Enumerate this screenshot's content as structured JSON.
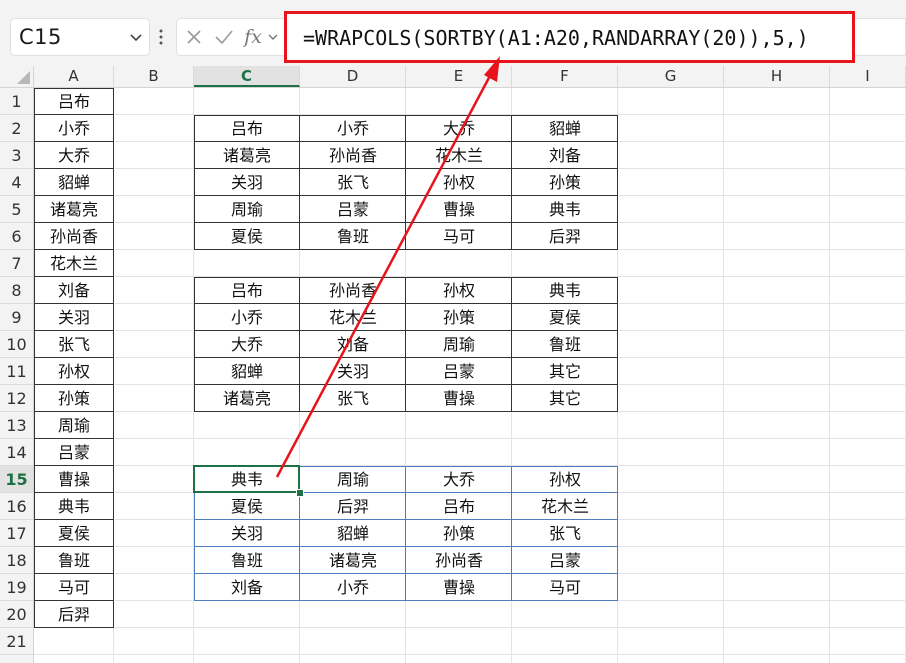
{
  "name_box": "C15",
  "formula": "=WRAPCOLS(SORTBY(A1:A20,RANDARRAY(20)),5,)",
  "columns": [
    "A",
    "B",
    "C",
    "D",
    "E",
    "F",
    "G",
    "H",
    "I"
  ],
  "selected_column": "C",
  "rows": [
    "1",
    "2",
    "3",
    "4",
    "5",
    "6",
    "7",
    "8",
    "9",
    "10",
    "11",
    "12",
    "13",
    "14",
    "15",
    "16",
    "17",
    "18",
    "19",
    "20",
    "21"
  ],
  "selected_row": "15",
  "source_list": [
    "吕布",
    "小乔",
    "大乔",
    "貂蝉",
    "诸葛亮",
    "孙尚香",
    "花木兰",
    "刘备",
    "关羽",
    "张飞",
    "孙权",
    "孙策",
    "周瑜",
    "吕蒙",
    "曹操",
    "典韦",
    "夏侯",
    "鲁班",
    "马可",
    "后羿"
  ],
  "table1": [
    [
      "吕布",
      "小乔",
      "大乔",
      "貂蝉"
    ],
    [
      "诸葛亮",
      "孙尚香",
      "花木兰",
      "刘备"
    ],
    [
      "关羽",
      "张飞",
      "孙权",
      "孙策"
    ],
    [
      "周瑜",
      "吕蒙",
      "曹操",
      "典韦"
    ],
    [
      "夏侯",
      "鲁班",
      "马可",
      "后羿"
    ]
  ],
  "table2": [
    [
      "吕布",
      "孙尚香",
      "孙权",
      "典韦"
    ],
    [
      "小乔",
      "花木兰",
      "孙策",
      "夏侯"
    ],
    [
      "大乔",
      "刘备",
      "周瑜",
      "鲁班"
    ],
    [
      "貂蝉",
      "关羽",
      "吕蒙",
      "其它"
    ],
    [
      "诸葛亮",
      "张飞",
      "曹操",
      "其它"
    ]
  ],
  "table3": [
    [
      "典韦",
      "周瑜",
      "大乔",
      "孙权"
    ],
    [
      "夏侯",
      "后羿",
      "吕布",
      "花木兰"
    ],
    [
      "关羽",
      "貂蝉",
      "孙策",
      "张飞"
    ],
    [
      "鲁班",
      "诸葛亮",
      "孙尚香",
      "吕蒙"
    ],
    [
      "刘备",
      "小乔",
      "曹操",
      "马可"
    ]
  ],
  "colors": {
    "highlight_red": "#e8141c",
    "excel_green": "#1e7145",
    "spill_blue": "#4f7dbd"
  },
  "icons": [
    "chevron-down-icon",
    "more-vertical-icon",
    "cancel-x-icon",
    "confirm-check-icon",
    "fx-icon",
    "chevron-down-icon"
  ]
}
